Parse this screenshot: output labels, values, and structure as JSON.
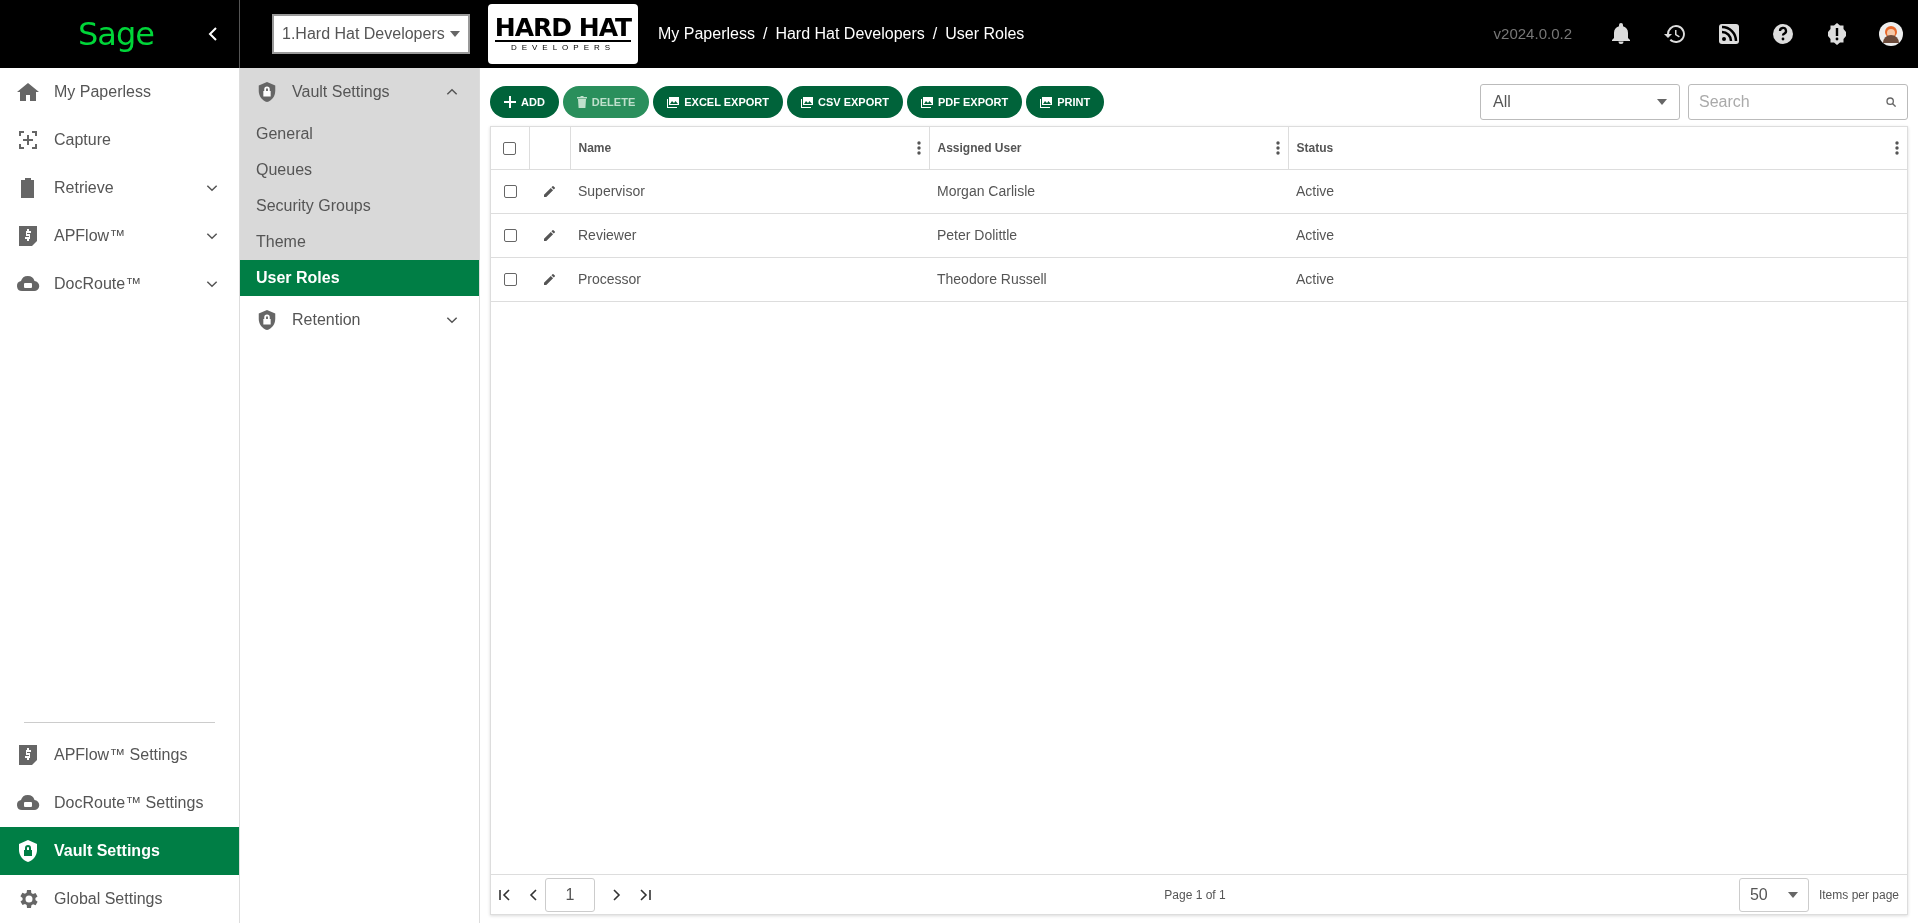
{
  "topbar": {
    "logo": "Sage",
    "vault_select": {
      "value": "1.Hard Hat Developers"
    },
    "brand": {
      "line1": "HARD HAT",
      "line2": "DEVELOPERS"
    },
    "breadcrumb": {
      "links": [
        "My Paperless",
        "Hard Hat Developers",
        "User Roles"
      ],
      "separators": [
        "/",
        "/"
      ]
    },
    "version": "v2024.0.0.2"
  },
  "sidebar": {
    "items": [
      {
        "label": "My Paperless",
        "selected": false
      },
      {
        "label": "Capture",
        "selected": false
      },
      {
        "label": "Retrieve",
        "selected": false,
        "expanded": false
      },
      {
        "label": "APFlow™",
        "selected": false,
        "expanded": false
      },
      {
        "label": "DocRoute™",
        "selected": false,
        "expanded": false
      }
    ],
    "bottom_items": [
      {
        "label": "APFlow™ Settings",
        "selected": false
      },
      {
        "label": "DocRoute™ Settings",
        "selected": false
      },
      {
        "label": "Vault Settings",
        "selected": true
      },
      {
        "label": "Global Settings",
        "selected": false
      }
    ]
  },
  "submenu": {
    "groups": [
      {
        "label": "Vault Settings",
        "expanded": true,
        "children": [
          {
            "label": "General",
            "selected": false
          },
          {
            "label": "Queues",
            "selected": false
          },
          {
            "label": "Security Groups",
            "selected": false
          },
          {
            "label": "Theme",
            "selected": false
          },
          {
            "label": "User Roles",
            "selected": true
          }
        ]
      },
      {
        "label": "Retention",
        "expanded": false
      }
    ]
  },
  "toolbar": {
    "buttons": [
      {
        "label": "ADD",
        "kind": "add",
        "disabled": false
      },
      {
        "label": "DELETE",
        "kind": "delete",
        "disabled": true
      },
      {
        "label": "EXCEL EXPORT",
        "kind": "export",
        "disabled": false
      },
      {
        "label": "CSV EXPORT",
        "kind": "export",
        "disabled": false
      },
      {
        "label": "PDF EXPORT",
        "kind": "export",
        "disabled": false
      },
      {
        "label": "PRINT",
        "kind": "export",
        "disabled": false
      }
    ],
    "filter": {
      "value": "All"
    },
    "search": {
      "placeholder": "Search"
    }
  },
  "table": {
    "columns": [
      "Name",
      "Assigned User",
      "Status"
    ],
    "all_checked": false,
    "rows": [
      {
        "checked": false,
        "cells": [
          "Supervisor",
          "Morgan Carlisle",
          "Active"
        ]
      },
      {
        "checked": false,
        "cells": [
          "Reviewer",
          "Peter Dolittle",
          "Active"
        ]
      },
      {
        "checked": false,
        "cells": [
          "Processor",
          "Theodore Russell",
          "Active"
        ]
      }
    ]
  },
  "pager": {
    "page": "1",
    "info": "Page 1 of 1",
    "page_size": "50",
    "page_size_label": "Items per page"
  }
}
